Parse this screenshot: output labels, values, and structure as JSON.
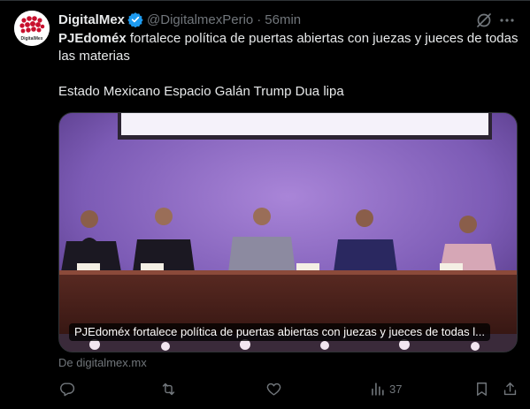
{
  "post": {
    "author_name": "DigitalMex",
    "handle": "@DigitalmexPerio",
    "separator": "·",
    "time": "56min",
    "text_bold": "PJEdoméx",
    "text_rest": " fortalece política de puertas abiertas con juezas y jueces de todas las materias",
    "tags_line": "Estado Mexicano Espacio Galán Trump Dua lipa",
    "media_caption": "PJEdoméx fortalece política de puertas abiertas con juezas y jueces de todas l...",
    "source": "De digitalmex.mx",
    "avatar_text": "DigitalMex"
  },
  "actions": {
    "reply_icon": "reply-icon",
    "repost_icon": "repost-icon",
    "like_icon": "heart-icon",
    "views_icon": "views-icon",
    "views_count": "37",
    "bookmark_icon": "bookmark-icon",
    "share_icon": "share-icon"
  },
  "colors": {
    "background": "#000000",
    "text_primary": "#e7e9ea",
    "text_secondary": "#71767b",
    "verified": "#1d9bf0",
    "avatar_dots": "#c8102e"
  }
}
